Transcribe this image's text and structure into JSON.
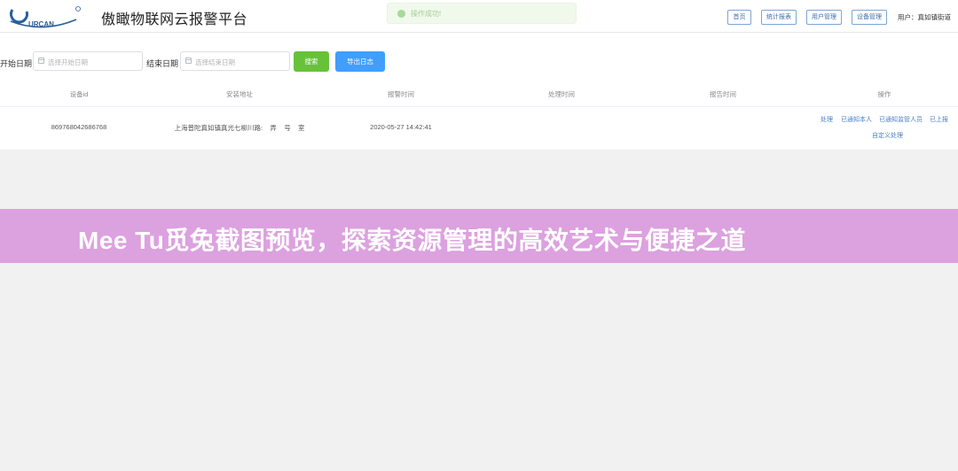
{
  "header": {
    "logo_text": "URCAN",
    "title": "傲瞰物联网云报警平台",
    "nav": [
      "首页",
      "统计报表",
      "用户管理",
      "设备管理"
    ],
    "user_text": "用户：真如镇街道"
  },
  "toast": {
    "text": "操作成功!",
    "icon": "success-check-icon"
  },
  "filter": {
    "start_label": "开始日期",
    "start_placeholder": "选择开始日期",
    "end_label": "结束日期",
    "end_placeholder": "选择结束日期",
    "search_label": "搜索",
    "export_label": "导出日志"
  },
  "table": {
    "headers": [
      "设备id",
      "安装地址",
      "报警时间",
      "处理时间",
      "报告时间",
      "操作"
    ],
    "rows": [
      {
        "device_id": "869768042686768",
        "address": "上海普陀真如镇真光七柳川路:    弄    号    室",
        "alarm_time": "2020-05-27 14:42:41",
        "handle_time": "",
        "report_time": "",
        "actions": [
          "处理",
          "已通知本人",
          "已通知监管人员",
          "已上报",
          "自定义处理"
        ]
      }
    ]
  },
  "banner": {
    "text": "Mee Tu觅兔截图预览，探索资源管理的高效艺术与便捷之道"
  },
  "colors": {
    "accent_blue": "#409eff",
    "success_green": "#67c23a",
    "link_blue": "#4a7fc4",
    "banner": "#dca1df"
  }
}
